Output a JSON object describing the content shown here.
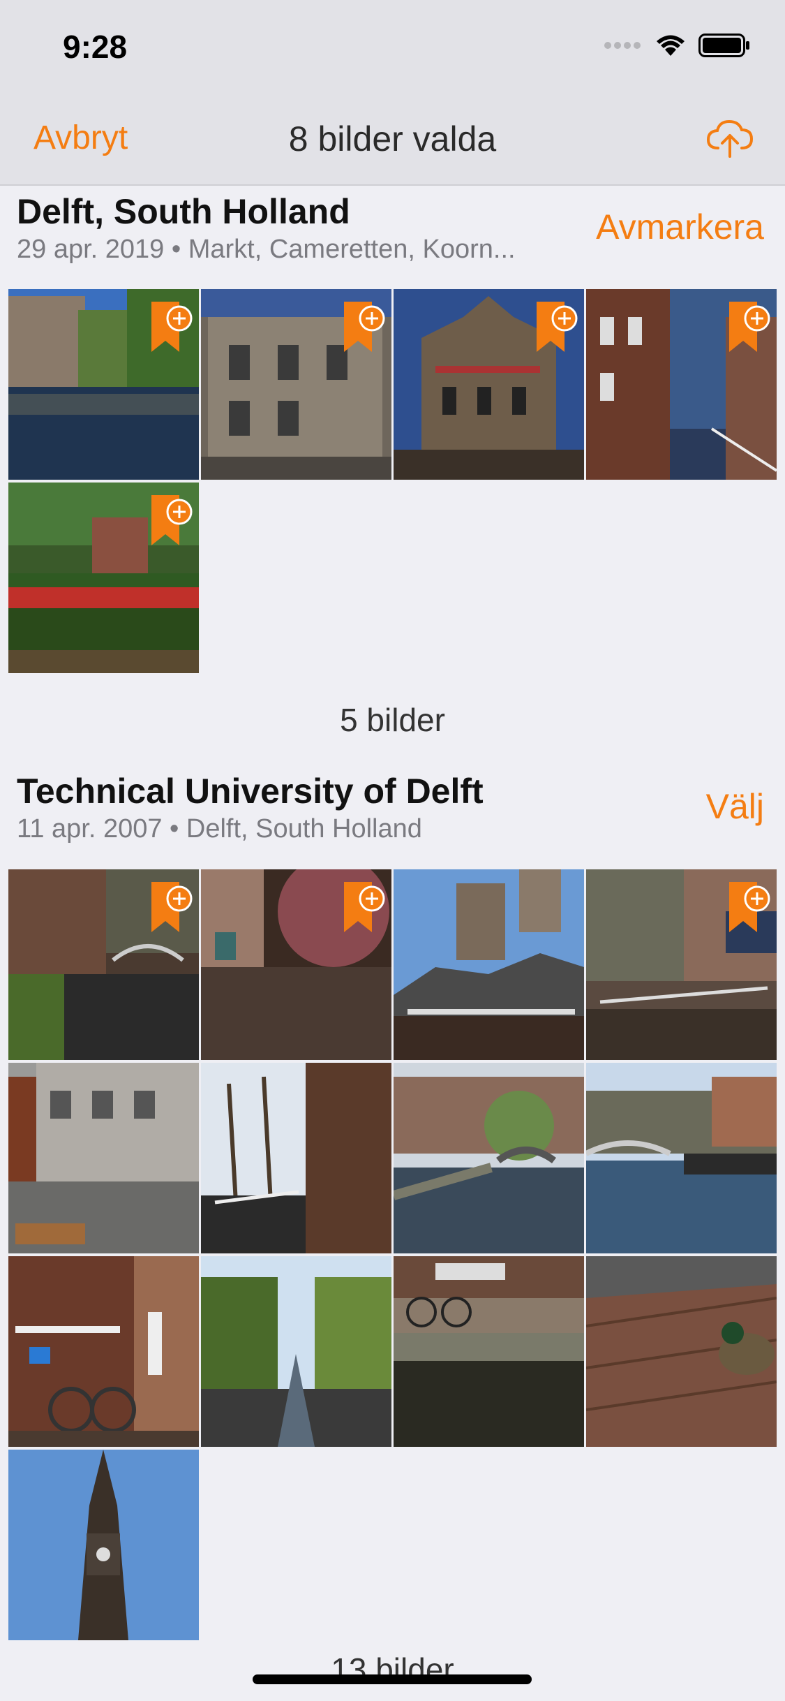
{
  "status": {
    "time": "9:28"
  },
  "nav": {
    "cancel_label": "Avbryt",
    "title": "8 bilder valda",
    "upload_icon": "cloud-upload-icon"
  },
  "colors": {
    "accent": "#f47d12",
    "background": "#efeff4"
  },
  "sections": [
    {
      "title": "Delft, South Holland",
      "subtitle": "29 apr. 2019 • Markt, Cameretten, Koorn...",
      "action": "Avmarkera",
      "count_label": "5 bilder",
      "photos": [
        {
          "name": "canal-reflection",
          "selected": true
        },
        {
          "name": "stone-building",
          "selected": true
        },
        {
          "name": "ornate-facade",
          "selected": true
        },
        {
          "name": "narrow-canal-street",
          "selected": true
        },
        {
          "name": "garden-flowers",
          "selected": true
        }
      ]
    },
    {
      "title": "Technical University of Delft",
      "subtitle": "11 apr. 2007 • Delft, South Holland",
      "action": "Välj",
      "count_label": "13 bilder",
      "photos": [
        {
          "name": "canal-bridge-trees",
          "selected": true
        },
        {
          "name": "blossom-canal",
          "selected": true
        },
        {
          "name": "town-hall-tower",
          "selected": false
        },
        {
          "name": "canal-houses",
          "selected": true
        },
        {
          "name": "square-cafe-cyclist",
          "selected": false
        },
        {
          "name": "church-wall-canal",
          "selected": false
        },
        {
          "name": "canal-bridge-street",
          "selected": false
        },
        {
          "name": "canal-quay-reflection",
          "selected": false
        },
        {
          "name": "bicycle-by-wall",
          "selected": false
        },
        {
          "name": "long-tree-canal",
          "selected": false
        },
        {
          "name": "canal-bikes-reflection",
          "selected": false
        },
        {
          "name": "duck-on-bricks",
          "selected": false
        },
        {
          "name": "church-spire",
          "selected": false
        }
      ]
    }
  ]
}
